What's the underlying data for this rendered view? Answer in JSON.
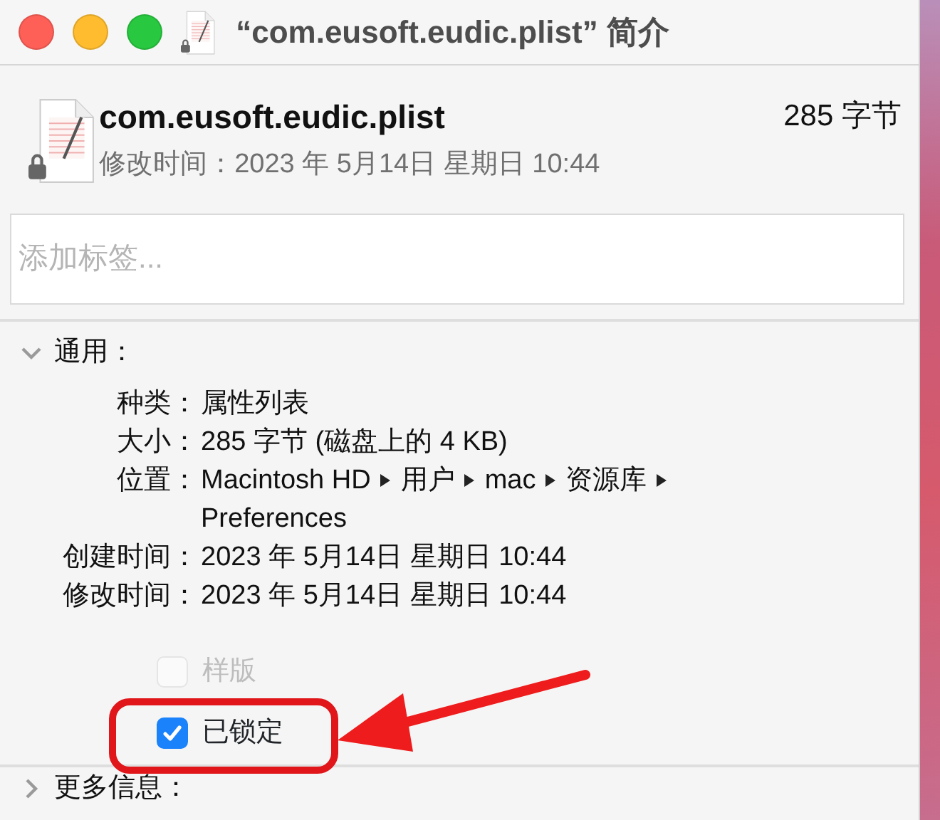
{
  "window": {
    "title": "“com.eusoft.eudic.plist” 简介"
  },
  "header": {
    "filename": "com.eusoft.eudic.plist",
    "size": "285 字节",
    "modified": "修改时间：2023 年 5月14日 星期日 10:44"
  },
  "tags_field": {
    "placeholder": "添加标签..."
  },
  "sections": [
    {
      "title": "通用：",
      "expanded": true,
      "rows": [
        {
          "kind": "text",
          "label": "种类：",
          "value": "属性列表"
        },
        {
          "kind": "text",
          "label": "大小：",
          "value": "285 字节 (磁盘上的 4 KB)"
        },
        {
          "kind": "path",
          "label": "位置：",
          "segments": [
            "Macintosh HD",
            "用户",
            "mac",
            "资源库",
            "Preferences"
          ]
        },
        {
          "kind": "text",
          "label": "创建时间：",
          "value": "2023 年 5月14日 星期日 10:44"
        },
        {
          "kind": "text",
          "label": "修改时间：",
          "value": "2023 年 5月14日 星期日 10:44"
        }
      ],
      "checkboxes": [
        {
          "label": "样版",
          "checked": false,
          "disabled": true
        },
        {
          "label": "已锁定",
          "checked": true,
          "disabled": false
        }
      ]
    },
    {
      "title": "更多信息：",
      "expanded": false
    }
  ]
}
